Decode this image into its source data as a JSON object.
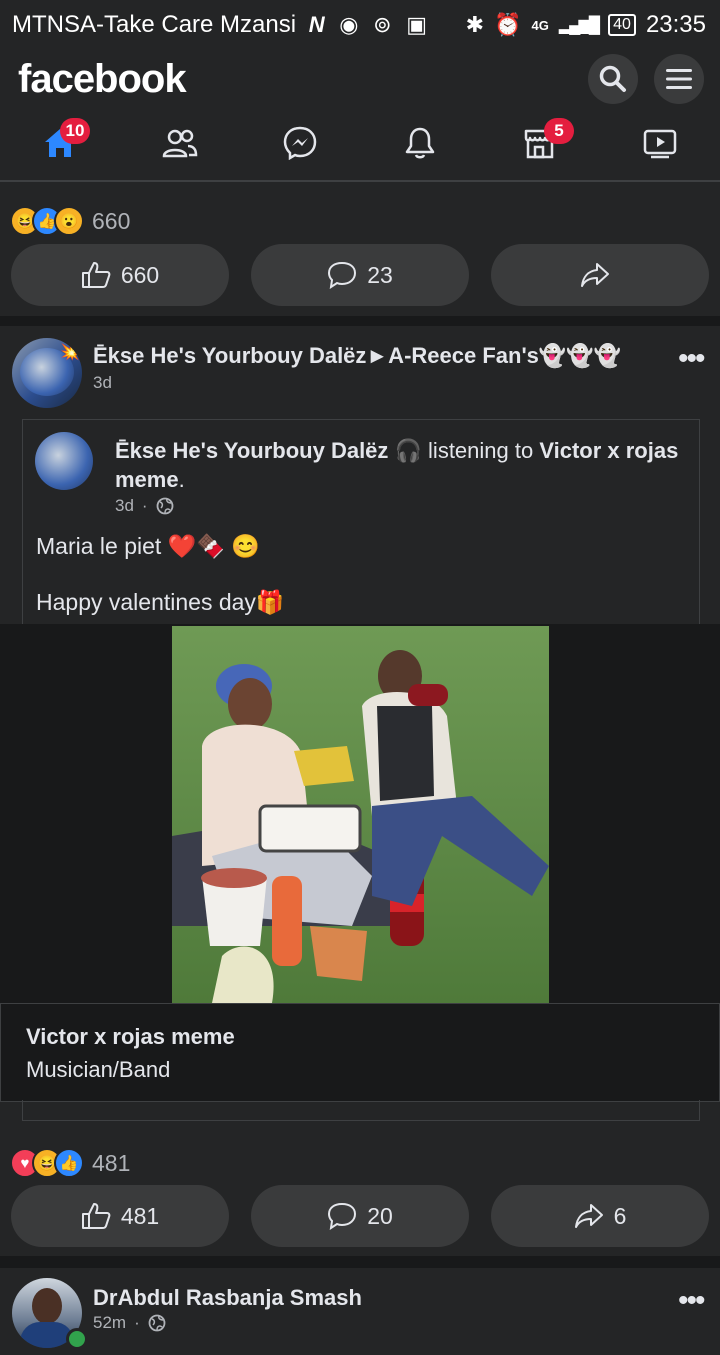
{
  "status_bar": {
    "carrier": "MTNSA-Take Care Mzansi",
    "network": "4G",
    "battery": "40",
    "time": "23:35"
  },
  "header": {
    "logo": "facebook",
    "icons": [
      "search-icon",
      "menu-icon"
    ]
  },
  "nav": {
    "items": [
      {
        "name": "home",
        "icon": "home-icon",
        "badge": "10",
        "active": true
      },
      {
        "name": "friends",
        "icon": "friends-icon",
        "badge": ""
      },
      {
        "name": "messenger",
        "icon": "messenger-icon",
        "badge": ""
      },
      {
        "name": "notifications",
        "icon": "bell-icon",
        "badge": ""
      },
      {
        "name": "marketplace",
        "icon": "marketplace-icon",
        "badge": "5"
      },
      {
        "name": "watch",
        "icon": "watch-icon",
        "badge": ""
      }
    ],
    "accent": "#2d88ff",
    "badge_color": "#e41e3f"
  },
  "post1": {
    "reaction_count": "660",
    "like_count": "660",
    "comment_count": "23",
    "share_count": ""
  },
  "post2": {
    "author": "Ēkse He's Yourbouy Dalëz►A-Reece Fan's👻👻👻",
    "time": "3d",
    "shared": {
      "author": "Ēkse He's Yourbouy Dalëz",
      "activity_prefix": " 🎧 listening to ",
      "activity_target": "Victor x rojas meme",
      "activity_suffix": ".",
      "time": "3d",
      "privacy_icon": "globe-icon",
      "text_line1": "Maria le piet ❤️🍫 😊",
      "text_line2": "Happy valentines day🎁"
    },
    "music": {
      "title": "Victor x rojas meme",
      "category": "Musician/Band"
    },
    "reaction_count": "481",
    "like_count": "481",
    "comment_count": "20",
    "share_count": "6"
  },
  "post3": {
    "author": "DrAbdul Rasbanja Smash",
    "time": "52m",
    "privacy_icon": "globe-icon"
  }
}
